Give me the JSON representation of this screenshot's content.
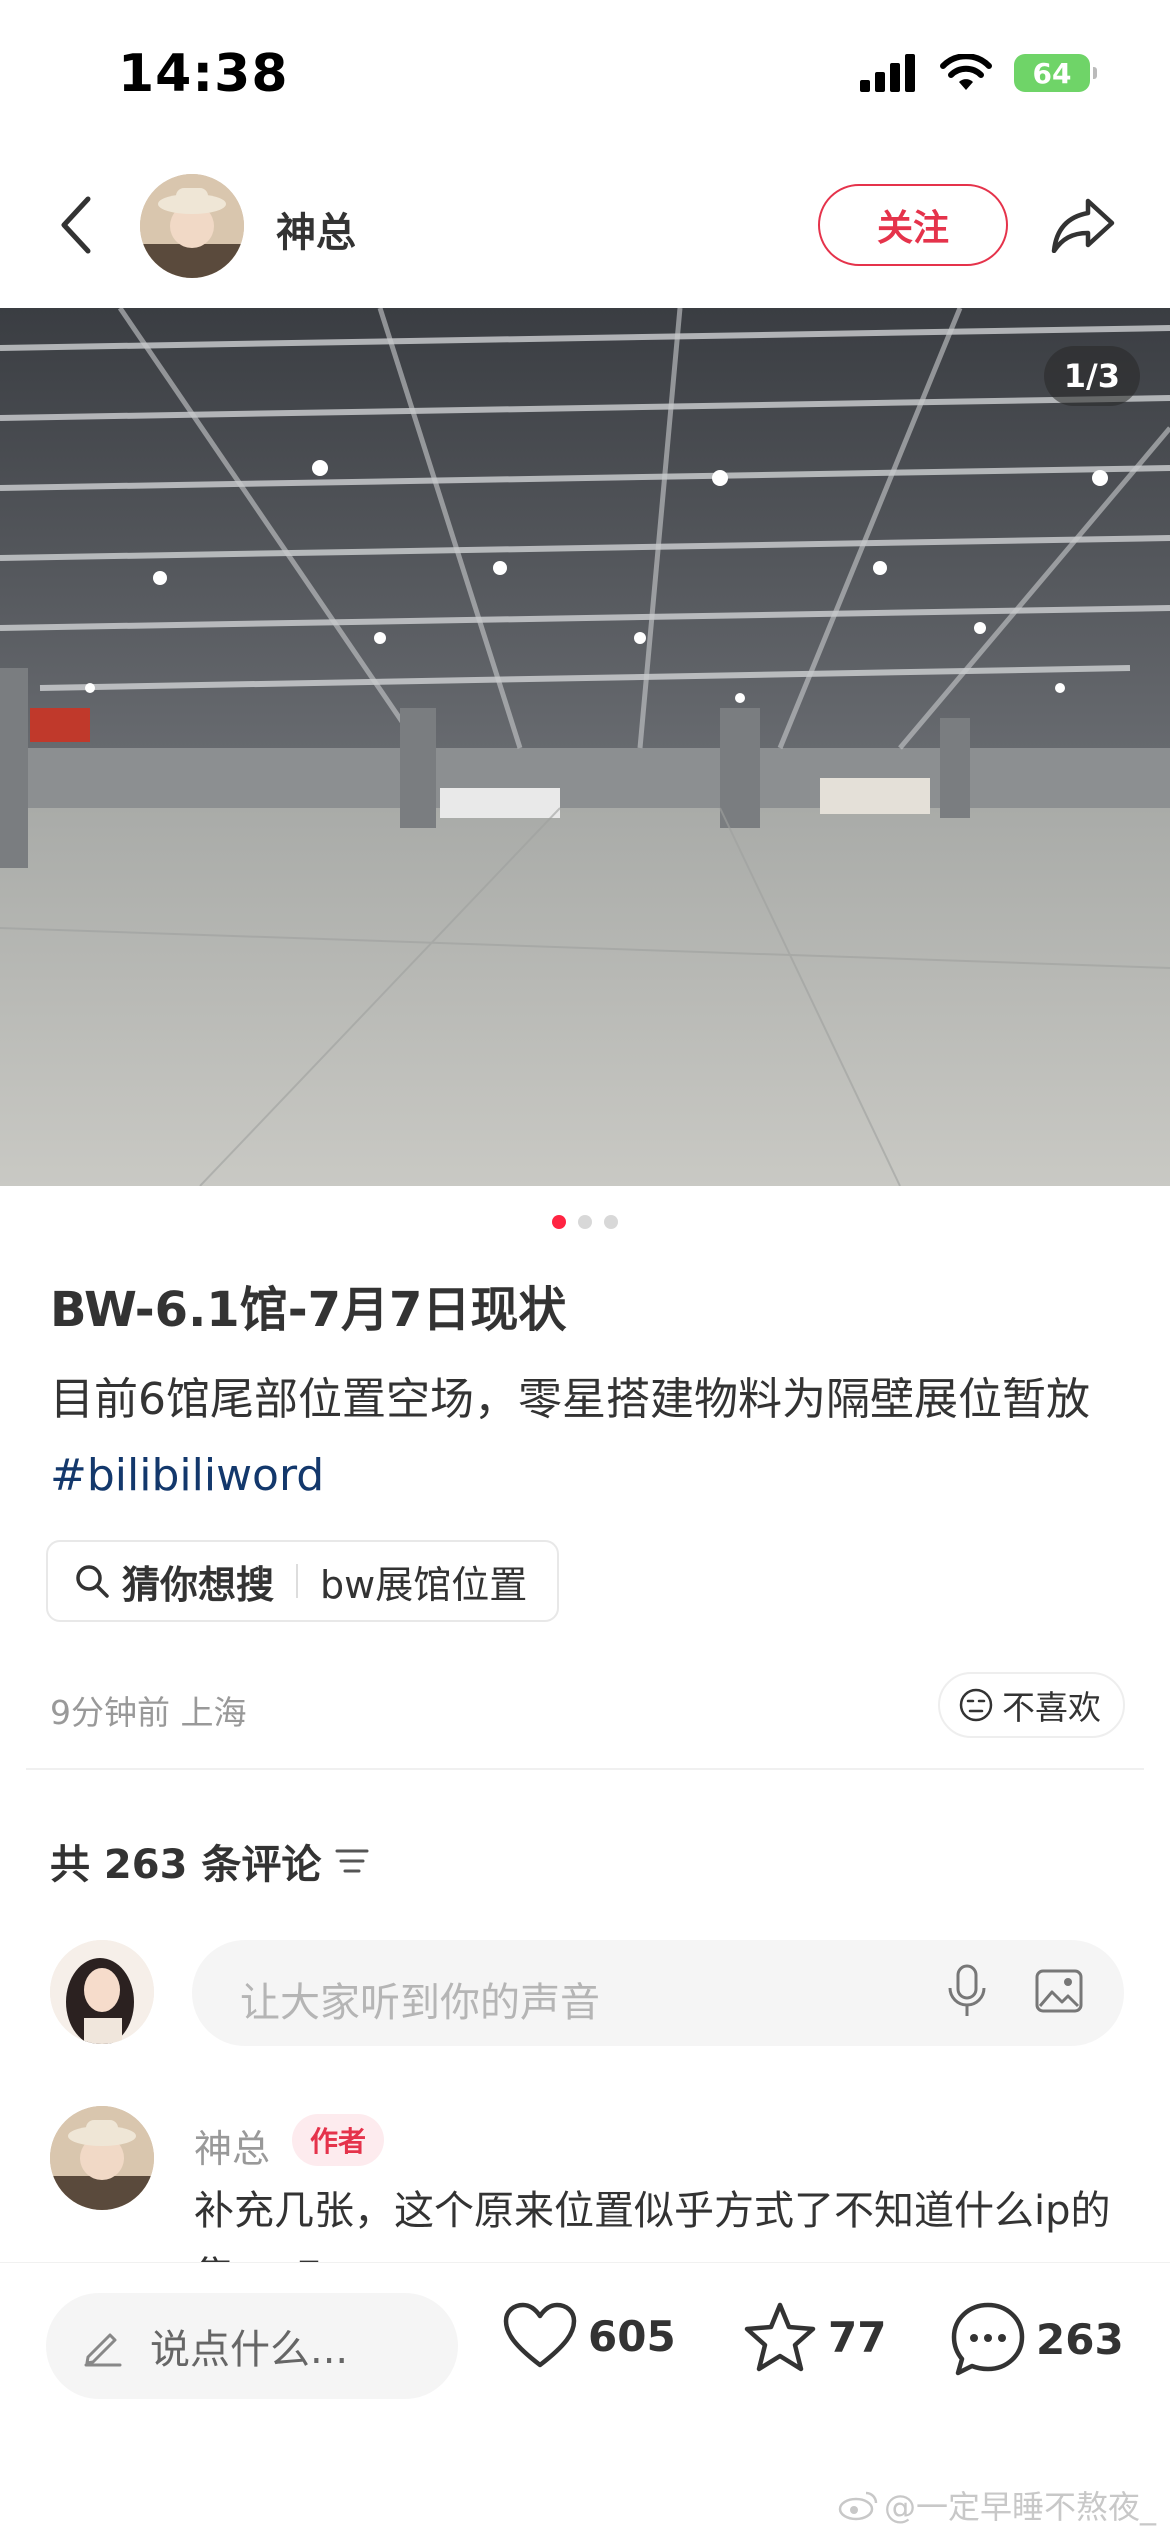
{
  "status_bar": {
    "time": "14:38",
    "battery": "64"
  },
  "header": {
    "author_name": "神总",
    "follow_label": "关注"
  },
  "image": {
    "counter": "1/3",
    "total_images": 3,
    "active_index": 0
  },
  "note": {
    "title": "BW-6.1馆-7月7日现状",
    "body": "目前6馆尾部位置空场，零星搭建物料为隔壁展位暂放",
    "hashtag": "#bilibiliword",
    "search_chip": {
      "label": "猜你想搜",
      "query": "bw展馆位置"
    },
    "meta": "9分钟前 上海",
    "dislike_label": "不喜欢"
  },
  "comments": {
    "count_label": "共 263 条评论",
    "input_placeholder": "让大家听到你的声音",
    "items": [
      {
        "author": "神总",
        "badge": "作者",
        "text": "补充几张，这个原来位置似乎方式了不知道什么ip的集serE..."
      }
    ]
  },
  "bottom_bar": {
    "say_placeholder": "说点什么...",
    "likes": "605",
    "stars": "77",
    "comments": "263"
  },
  "watermark": "@一定早睡不熬夜_",
  "colors": {
    "accent": "#ff2442",
    "hashtag": "#13386c",
    "battery": "#6fd468"
  }
}
